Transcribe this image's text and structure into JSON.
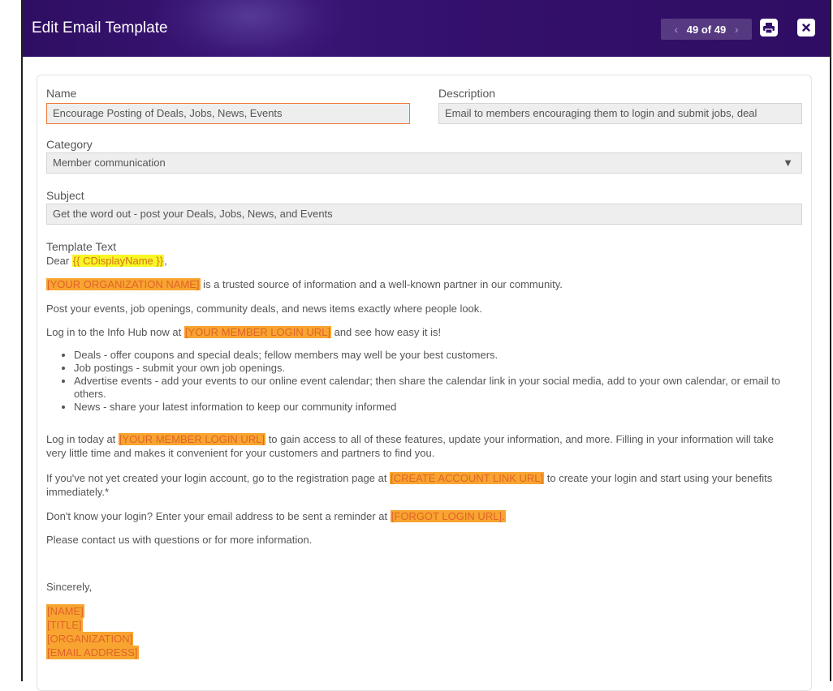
{
  "window": {
    "title": "Edit Email Template",
    "pager": {
      "prev": "‹",
      "count": "49 of 49",
      "next": "›"
    }
  },
  "form": {
    "name_label": "Name",
    "name_value": "Encourage Posting of Deals, Jobs, News, Events",
    "description_label": "Description",
    "description_value": "Email to members encouraging them to login and submit jobs, deal",
    "category_label": "Category",
    "category_value": "Member communication",
    "subject_label": "Subject",
    "subject_value": "Get the word out - post your Deals, Jobs, News, and Events",
    "template_label": "Template Text"
  },
  "template": {
    "greeting_pre": "Dear ",
    "greeting_token": "{{ CDisplayName }}",
    "greeting_post": ",",
    "p1_token": "[YOUR ORGANIZATION NAME]",
    "p1_text": " is a trusted source of information and a well-known partner in our community.",
    "p2_text": "Post your events, job openings, community deals, and news items exactly where people look.",
    "p3_pre": "Log in to the Info Hub now at ",
    "p3_token": "[YOUR MEMBER LOGIN URL]",
    "p3_post": " and see how easy it is!",
    "bullets": [
      "Deals - offer coupons and special deals; fellow members may well be your best customers.",
      "Job postings - submit your own job openings.",
      "Advertise events - add your events to our online event calendar; then share the calendar link in your social media, add to your own calendar, or email to others.",
      "News - share your latest information to keep our community informed"
    ],
    "p4_pre": "Log in today at ",
    "p4_token": "[YOUR MEMBER LOGIN URL]",
    "p4_post": " to gain access to all of these features, update your information, and more.  Filling in your information will take very little time and makes it convenient for your customers and partners to find you.",
    "p5_pre": "If you've not yet created your login account, go to the registration page at ",
    "p5_token": "[CREATE ACCOUNT LINK URL]",
    "p5_post": " to create your login and start using your benefits immediately.*",
    "p6_pre": "Don't know your login? Enter your email address to be sent a reminder at ",
    "p6_token": "[FORGOT LOGIN URL].",
    "p7_text": "Please contact us with questions or for more information.",
    "closing": "Sincerely,",
    "sig_name": "[NAME]",
    "sig_title": "[TITLE]",
    "sig_org": "[ORGANIZATION]",
    "sig_email": "[EMAIL ADDRESS]"
  },
  "colors": {
    "header_bg": "#33106b",
    "placeholder_highlight": "#f7a530",
    "merge_field_highlight": "#f8f624",
    "active_field_border": "#f07a3a"
  },
  "icons": {
    "print": "printer-icon",
    "close": "close-icon"
  }
}
